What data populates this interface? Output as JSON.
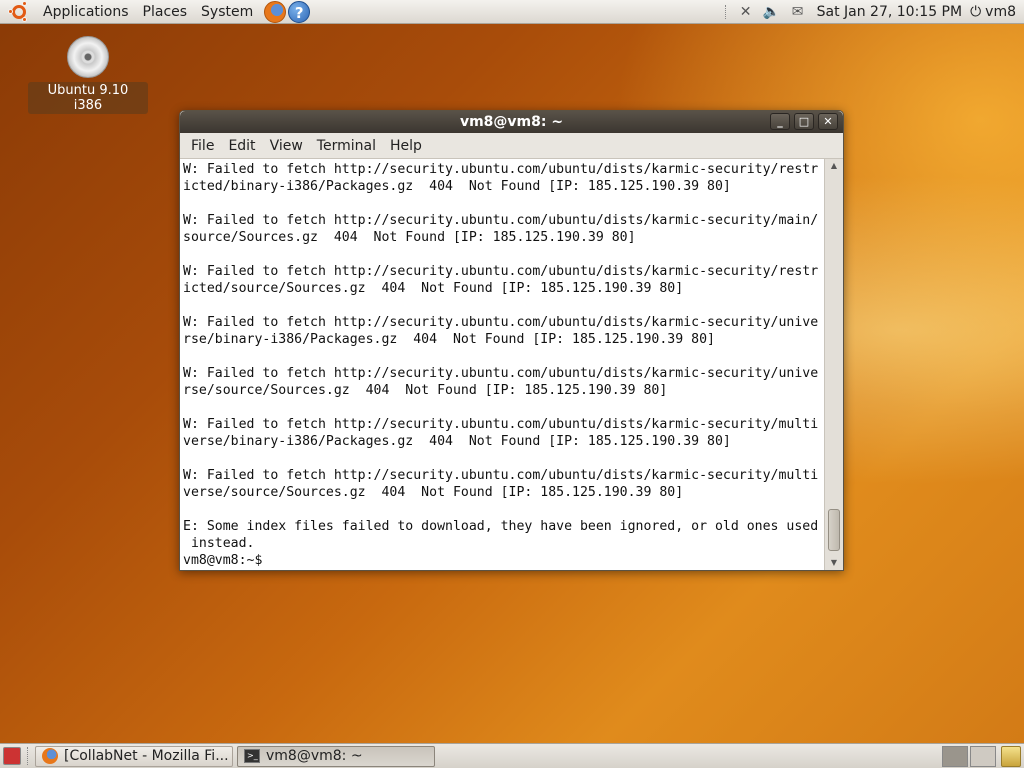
{
  "top_panel": {
    "menus": [
      "Applications",
      "Places",
      "System"
    ],
    "clock": "Sat Jan 27, 10:15 PM",
    "user": "vm8",
    "icons": [
      "ubuntu-logo-icon",
      "firefox-icon",
      "help-icon",
      "network-icon",
      "volume-icon",
      "mail-icon",
      "power-icon"
    ]
  },
  "desktop": {
    "cd_label": "Ubuntu 9.10 i386"
  },
  "terminal": {
    "title": "vm8@vm8: ~",
    "menus": [
      "File",
      "Edit",
      "View",
      "Terminal",
      "Help"
    ],
    "lines": [
      "W: Failed to fetch http://security.ubuntu.com/ubuntu/dists/karmic-security/restr",
      "icted/binary-i386/Packages.gz  404  Not Found [IP: 185.125.190.39 80]",
      "",
      "W: Failed to fetch http://security.ubuntu.com/ubuntu/dists/karmic-security/main/",
      "source/Sources.gz  404  Not Found [IP: 185.125.190.39 80]",
      "",
      "W: Failed to fetch http://security.ubuntu.com/ubuntu/dists/karmic-security/restr",
      "icted/source/Sources.gz  404  Not Found [IP: 185.125.190.39 80]",
      "",
      "W: Failed to fetch http://security.ubuntu.com/ubuntu/dists/karmic-security/unive",
      "rse/binary-i386/Packages.gz  404  Not Found [IP: 185.125.190.39 80]",
      "",
      "W: Failed to fetch http://security.ubuntu.com/ubuntu/dists/karmic-security/unive",
      "rse/source/Sources.gz  404  Not Found [IP: 185.125.190.39 80]",
      "",
      "W: Failed to fetch http://security.ubuntu.com/ubuntu/dists/karmic-security/multi",
      "verse/binary-i386/Packages.gz  404  Not Found [IP: 185.125.190.39 80]",
      "",
      "W: Failed to fetch http://security.ubuntu.com/ubuntu/dists/karmic-security/multi",
      "verse/source/Sources.gz  404  Not Found [IP: 185.125.190.39 80]",
      "",
      "E: Some index files failed to download, they have been ignored, or old ones used",
      " instead.",
      "vm8@vm8:~$"
    ]
  },
  "taskbar": {
    "tasks": [
      {
        "label": "[CollabNet - Mozilla Fi...",
        "icon": "firefox-icon",
        "active": false
      },
      {
        "label": "vm8@vm8: ~",
        "icon": "terminal-icon",
        "active": true
      }
    ]
  }
}
